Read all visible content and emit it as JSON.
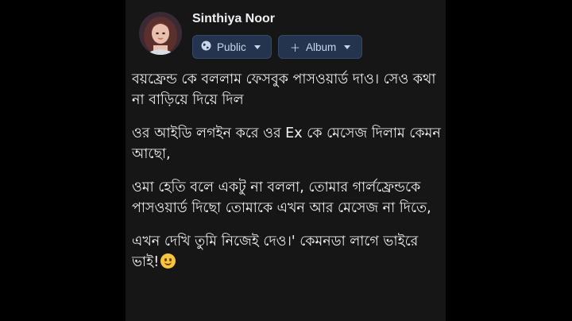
{
  "post": {
    "author": "Sinthiya Noor",
    "audience_label": "Public",
    "album_label": "Album",
    "paragraphs": [
      "বয়ফ্রেন্ড কে বললাম ফেসবুক পাসওয়ার্ড দাও। সেও কথা না বাড়িয়ে দিয়ে দিল",
      "ওর আইডি লগইন করে ওর Ex কে মেসেজ দিলাম কেমন আছো,",
      "ওমা হেতি বলে একটু না বললা, তোমার গার্লফ্রেন্ডকে পাসওয়ার্ড দিছো তোমাকে এখন আর মেসেজ না দিতে,",
      "এখন দেখি তুমি নিজেই দেও।' কেমনডা লাগে ভাইরে ভাই!"
    ],
    "icons": {
      "audience": "globe-icon",
      "album": "plus-icon",
      "emoji": "smiling-face-emoji"
    }
  },
  "colors": {
    "panel_bg": "#161616",
    "pill_bg": "#24344f",
    "text": "#f2f2f2"
  }
}
